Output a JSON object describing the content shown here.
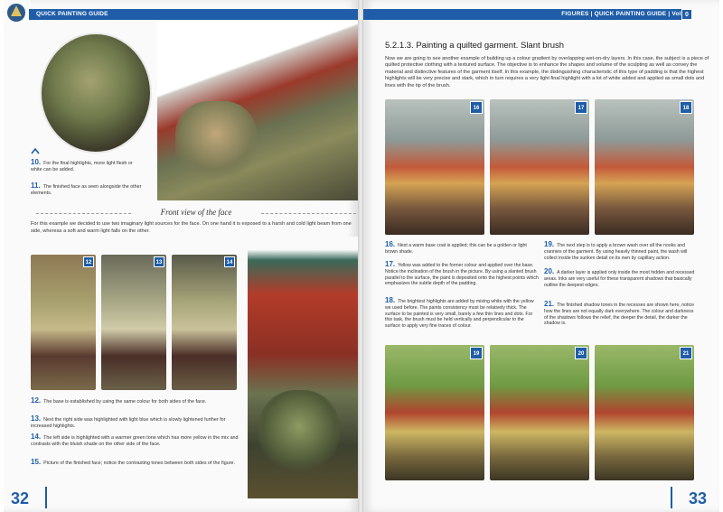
{
  "left_page": {
    "header": "QUICK PAINTING GUIDE",
    "section_title": "Front view of the face",
    "intro_text": "For this example we decided to use two imaginary light sources for the face. On one hand it is exposed to a harsh and cold light beam from one side, whereas a soft and warm light falls on the other.",
    "captions": [
      {
        "num": "10.",
        "text": "For the final highlights, more light flesh or white can be added."
      },
      {
        "num": "11.",
        "text": "The finished face as seen alongside the other elements."
      },
      {
        "num": "12.",
        "text": "The base is established by using the same colour for both sides of the face."
      },
      {
        "num": "13.",
        "text": "Next the right side was highlighted with light blue which is slowly lightened further for increased highlights."
      },
      {
        "num": "14.",
        "text": "The left side is highlighted with a warmer green tone which has more yellow in the mix and contrasts with the bluish shade on the other side of the face."
      },
      {
        "num": "15.",
        "text": "Picture of the finished face; notice the contrasting tones between both sides of the figure."
      }
    ],
    "thumb_numbers": [
      "12",
      "13",
      "14"
    ],
    "page_number": "32"
  },
  "right_page": {
    "header": "FIGURES",
    "header_sep": "|",
    "header_guide": "QUICK PAINTING GUIDE",
    "header_vol": "Vol:",
    "vol_number": "0",
    "title": "5.2.1.3. Painting a quilted garment. Slant brush",
    "intro_text": "Now we are going to see another example of building up a colour gradient by overlapping wet-on-dry layers. In this case, the subject is a piece of quilted protective clothing with a textured surface. The objective is to enhance the shapes and volume of the sculpting as well as convey the material and distinctive features of the garment itself. In this example, the distinguishing characteristic of this type of padding is that the highest highlights will be very precise and stark, which in turn requires a very light final highlight with a lot of white added and applied as small dots and lines with the tip of the brush.",
    "photo_numbers_top": [
      "16",
      "17",
      "18"
    ],
    "photo_numbers_bottom": [
      "19",
      "20",
      "21"
    ],
    "captions_col1": [
      {
        "num": "16.",
        "text": "Next a warm base coat is applied; this can be a golden or light brown shade."
      },
      {
        "num": "17.",
        "text": "Yellow was added to the former colour and applied over the base. Notice the inclination of the brush in the picture. By using a slanted brush parallel to the surface, the paint is deposited onto the highest points which emphasizes the subtle depth of the padding."
      },
      {
        "num": "18.",
        "text": "The brightest highlights are added by mixing white with the yellow we used before. The paints consistency must be relatively thick. The surface to be painted is very small, barely a few thin lines and dots. For this task, the brush must be held vertically and perpendicular to the surface to apply very fine traces of colour."
      }
    ],
    "captions_col2": [
      {
        "num": "19.",
        "text": "The next step is to apply a brown wash over all the nooks and crannies of the garment. By using heavily thinned paint, the wash will collect inside the sunken detail on its own by capillary action."
      },
      {
        "num": "20.",
        "text": "A darker layer is applied only inside the most hidden and recessed areas. Inks are very useful for these transparent shadows that basically outline the deepest edges."
      },
      {
        "num": "21.",
        "text": "The finished shadow tones in the recesses are shown here, notice how the lines are not equally dark everywhere. The colour and darkness of the shadows follows the relief, the deeper the detail, the darker the shadow is."
      }
    ],
    "page_number": "33"
  },
  "colors": {
    "accent": "#1f5da8",
    "text": "#222222"
  }
}
